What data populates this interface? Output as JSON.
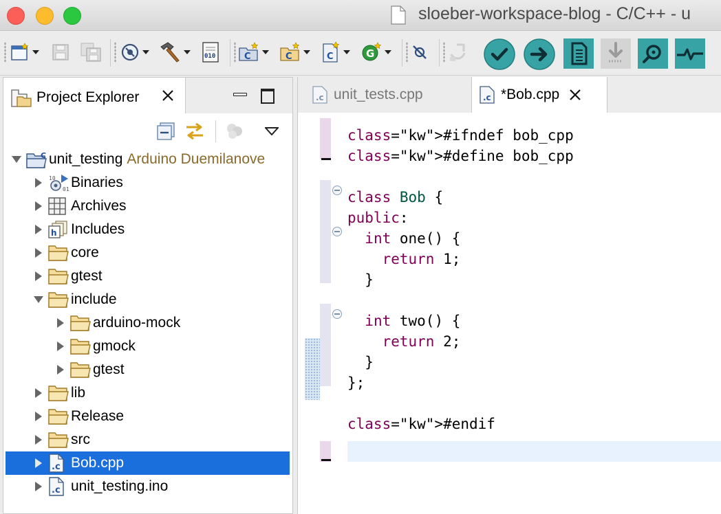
{
  "window": {
    "title": "sloeber-workspace-blog - C/C++ - u"
  },
  "toolbar": {
    "buttons": [
      {
        "name": "new-icon",
        "dropdown": true
      },
      {
        "name": "save-icon",
        "dropdown": false
      },
      {
        "name": "save-all-icon",
        "dropdown": false
      },
      {
        "name": "build-settings-icon",
        "dropdown": true
      },
      {
        "name": "hammer-build-icon",
        "dropdown": true
      },
      {
        "name": "binary-010-icon",
        "dropdown": false
      },
      {
        "name": "new-c-project-icon",
        "dropdown": true
      },
      {
        "name": "new-source-folder-icon",
        "dropdown": true
      },
      {
        "name": "new-c-file-icon",
        "dropdown": true
      },
      {
        "name": "new-class-icon",
        "dropdown": true
      },
      {
        "name": "debug-icon",
        "dropdown": false
      },
      {
        "name": "refresh-icon",
        "dropdown": false
      },
      {
        "name": "verify-icon",
        "dropdown": false
      },
      {
        "name": "upload-icon",
        "dropdown": false
      },
      {
        "name": "program-icon",
        "dropdown": false
      },
      {
        "name": "download-icon",
        "dropdown": false
      },
      {
        "name": "serial-monitor-icon",
        "dropdown": false
      },
      {
        "name": "serial-plotter-icon",
        "dropdown": false
      }
    ],
    "accent": "#36a0a4"
  },
  "explorer": {
    "tab_label": "Project Explorer",
    "tree": [
      {
        "label": "unit_testing",
        "decoration": "Arduino Duemilanove",
        "depth": 0,
        "expanded": true,
        "icon": "project-icon"
      },
      {
        "label": "Binaries",
        "depth": 1,
        "expanded": false,
        "icon": "binaries-icon"
      },
      {
        "label": "Archives",
        "depth": 1,
        "expanded": false,
        "icon": "archives-icon"
      },
      {
        "label": "Includes",
        "depth": 1,
        "expanded": false,
        "icon": "includes-icon"
      },
      {
        "label": "core",
        "depth": 1,
        "expanded": false,
        "icon": "folder-icon"
      },
      {
        "label": "gtest",
        "depth": 1,
        "expanded": false,
        "icon": "folder-icon"
      },
      {
        "label": "include",
        "depth": 1,
        "expanded": true,
        "icon": "folder-icon"
      },
      {
        "label": "arduino-mock",
        "depth": 2,
        "expanded": false,
        "icon": "folder-icon"
      },
      {
        "label": "gmock",
        "depth": 2,
        "expanded": false,
        "icon": "folder-icon"
      },
      {
        "label": "gtest",
        "depth": 2,
        "expanded": false,
        "icon": "folder-icon"
      },
      {
        "label": "lib",
        "depth": 1,
        "expanded": false,
        "icon": "folder-icon"
      },
      {
        "label": "Release",
        "depth": 1,
        "expanded": false,
        "icon": "folder-icon"
      },
      {
        "label": "src",
        "depth": 1,
        "expanded": false,
        "icon": "folder-icon"
      },
      {
        "label": "Bob.cpp",
        "depth": 1,
        "expanded": false,
        "icon": "c-file-icon",
        "selected": true
      },
      {
        "label": "unit_testing.ino",
        "depth": 1,
        "expanded": false,
        "icon": "c-file-icon"
      }
    ],
    "selection_color": "#1a6fdc"
  },
  "editor": {
    "tabs": [
      {
        "label": "unit_tests.cpp",
        "active": false
      },
      {
        "label": "*Bob.cpp",
        "active": true
      }
    ],
    "lines": [
      "#ifndef bob_cpp",
      "#define bob_cpp",
      "",
      "class Bob {",
      "public:",
      "  int one() {",
      "    return 1;",
      "  }",
      "",
      "  int two() {",
      "    return 2;",
      "  }",
      "};",
      "",
      "#endif"
    ],
    "keyword_color": "#7f0055"
  }
}
